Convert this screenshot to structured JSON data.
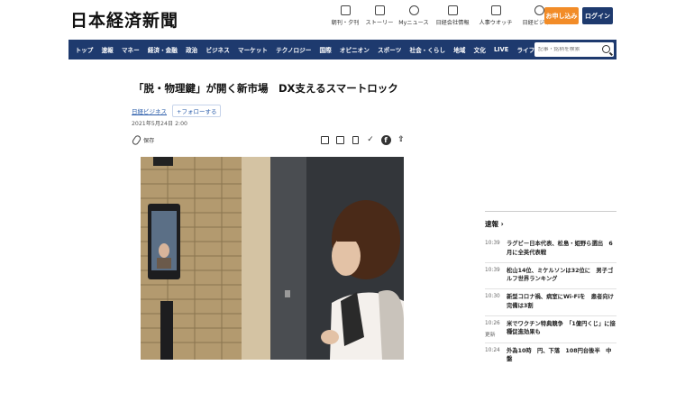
{
  "header": {
    "logo": "日本経済新聞",
    "links": [
      {
        "label": "朝刊・夕刊",
        "icon": "newspaper-icon"
      },
      {
        "label": "ストーリー",
        "icon": "phone-icon"
      },
      {
        "label": "Myニュース",
        "icon": "user-icon"
      },
      {
        "label": "日経会社情報",
        "icon": "chart-icon"
      },
      {
        "label": "人事ウオッチ",
        "icon": "magnifier-icon"
      },
      {
        "label": "日経ビジネス",
        "icon": "compass-icon"
      }
    ],
    "subscribe_label": "お申し込み",
    "login_label": "ログイン"
  },
  "nav": {
    "items": [
      "トップ",
      "速報",
      "マネー",
      "経済・金融",
      "政治",
      "ビジネス",
      "マーケット",
      "テクノロジー",
      "国際",
      "オピニオン",
      "スポーツ",
      "社会・くらし",
      "地域",
      "文化",
      "LIVE",
      "ライフ"
    ],
    "search_placeholder": "記事・銘柄を検索"
  },
  "article": {
    "headline": "「脱・物理鍵」が開く新市場　DX支えるスマートロック",
    "tag": "日経ビジネス",
    "follow_label": "フォローする",
    "date": "2021年5月24日 2:00",
    "save_label": "保存"
  },
  "sidebar": {
    "title": "速報 ›",
    "items": [
      {
        "time": "10:39",
        "text": "ラグビー日本代表、松島・姫野ら選出　6月に全英代表戦",
        "updated": ""
      },
      {
        "time": "10:39",
        "text": "松山14位、ミケルソンは32位に　男子ゴルフ世界ランキング",
        "updated": ""
      },
      {
        "time": "10:30",
        "text": "新型コロナ禍、病室にWi-Fiを　患者向け完備は3割",
        "updated": ""
      },
      {
        "time": "10:26",
        "text": "米でワクチン特典競争　「1億円くじ」に接種促進効果も",
        "updated": "更新"
      },
      {
        "time": "10:24",
        "text": "外為10時　円、下落　108円台後半　中盤",
        "updated": ""
      }
    ]
  },
  "colors": {
    "nav": "#1e3a6e",
    "subscribe": "#f28c28",
    "login": "#1e3a6e",
    "link": "#2a5caa"
  }
}
